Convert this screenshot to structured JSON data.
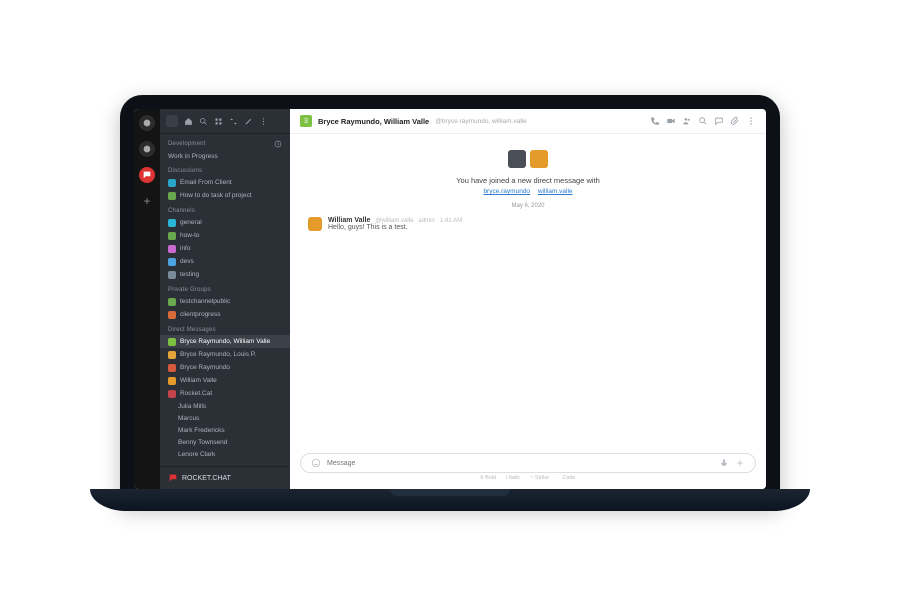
{
  "sidebar": {
    "dev_header": "Development",
    "dev_item": "Work in Progress",
    "disc_header": "Discussions",
    "disc_items": [
      {
        "label": "Email From Client",
        "color": "#2aa6c9"
      },
      {
        "label": "How to do task of project",
        "color": "#6aa84f"
      }
    ],
    "ch_header": "Channels",
    "ch_items": [
      {
        "label": "general",
        "color": "#29b6d6"
      },
      {
        "label": "how-to",
        "color": "#6aa84f"
      },
      {
        "label": "info",
        "color": "#c96ad1"
      },
      {
        "label": "devs",
        "color": "#4aa3e0"
      },
      {
        "label": "testing",
        "color": "#7a8b9a"
      }
    ],
    "pg_header": "Private Groups",
    "pg_items": [
      {
        "label": "testchannelpublic",
        "color": "#6aa84f"
      },
      {
        "label": "clientprogress",
        "color": "#d66a3a"
      }
    ],
    "dm_header": "Direct Messages",
    "dm_items": [
      {
        "label": "Bryce Raymundo, William Valle",
        "color": "#7cc142",
        "selected": true
      },
      {
        "label": "Bryce Raymundo, Louis P.",
        "color": "#e5a43a"
      },
      {
        "label": "Bryce Raymundo",
        "color": "#d6583a"
      },
      {
        "label": "William Valle",
        "color": "#e59a2c"
      },
      {
        "label": "Rocket.Cat",
        "color": "#c2444a"
      }
    ],
    "dm_sub_items": [
      "Julia Mills",
      "Marcus",
      "Mark Fredericks",
      "Benny Townsend",
      "Lenore Clark"
    ],
    "footer_brand": "ROCKET.CHAT"
  },
  "header": {
    "title": "Bryce Raymundo, William Valle",
    "subtitle": "@bryce.raymundo, william.valle"
  },
  "conversation": {
    "intro_text": "You have joined a new direct message with",
    "link_a": "bryce.raymundo",
    "link_b": "william.valle",
    "date": "May 6, 2020",
    "msg_name": "William Valle",
    "msg_user": "@william.valle",
    "msg_meta": "admin · 1:41 AM",
    "msg_text": "Hello, guys! This is a test."
  },
  "compose": {
    "placeholder": "Message"
  },
  "hints": {
    "a": "b Bold",
    "b": "i Italic",
    "c": "~ Strike",
    "d": "` Code"
  },
  "colors": {
    "av1": "#4a4f57",
    "av2": "#e59a2c"
  }
}
